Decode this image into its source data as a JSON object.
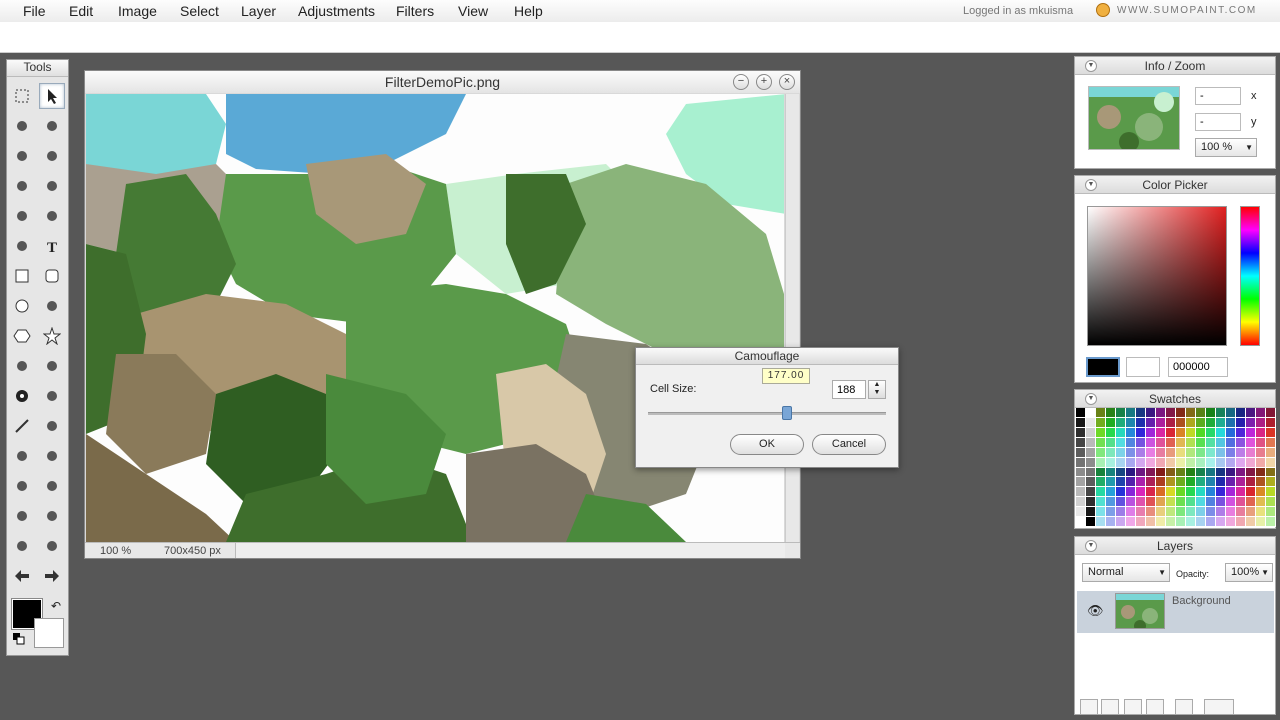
{
  "menubar": {
    "items": [
      "File",
      "Edit",
      "Image",
      "Select",
      "Layer",
      "Adjustments",
      "Filters",
      "View",
      "Help"
    ],
    "login_text": "Logged in as mkuisma",
    "brand": "WWW.SUMOPAINT.COM"
  },
  "tools": {
    "title": "Tools",
    "icons": [
      "marquee-icon",
      "arrow-icon",
      "magic-wand-icon",
      "lasso-icon",
      "brush-icon",
      "ink-brush-icon",
      "eraser-icon",
      "pencil-icon",
      "gradient-icon",
      "bucket-icon",
      "stamp-icon",
      "text-icon",
      "rectangle-icon",
      "rounded-rect-icon",
      "ellipse-icon",
      "spiral-icon",
      "hexagon-icon",
      "star-icon",
      "star-burst-icon",
      "star-outline-icon",
      "flower-icon",
      "gear-shape-icon",
      "line-icon",
      "curve-icon",
      "drop-icon",
      "smudge-icon",
      "crop-icon",
      "transform-icon",
      "hand-icon",
      "zoom-icon",
      "eyedropper-icon",
      "trash-icon",
      "undo-arrow-icon",
      "redo-arrow-icon"
    ],
    "fg_color": "#000000",
    "bg_color": "#ffffff"
  },
  "image_window": {
    "title": "FilterDemoPic.png",
    "zoom": "100 %",
    "size": "700x450 px"
  },
  "dialog": {
    "title": "Camouflage",
    "cell_label": "Cell Size:",
    "cell_value": "188",
    "tooltip": "177.00",
    "slider_fraction": 0.6,
    "ok_label": "OK",
    "cancel_label": "Cancel"
  },
  "info_panel": {
    "title": "Info / Zoom",
    "x_value": "-",
    "y_value": "-",
    "x_label": "x",
    "y_label": "y",
    "zoom": "100 %"
  },
  "color_picker": {
    "title": "Color Picker",
    "hex": "000000",
    "hue_color": "#e02020"
  },
  "swatches": {
    "title": "Swatches"
  },
  "layers": {
    "title": "Layers",
    "blend_mode": "Normal",
    "opacity_label": "Opacity:",
    "opacity": "100%",
    "layer_name": "Background"
  }
}
